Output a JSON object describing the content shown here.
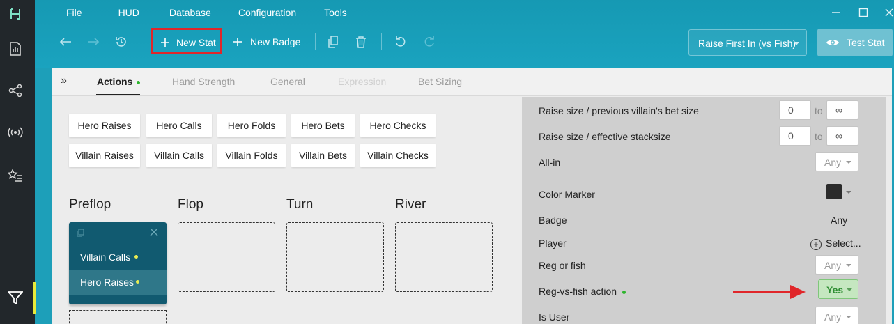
{
  "app": {
    "logo": "logo-h-icon"
  },
  "menu": [
    "File",
    "HUD",
    "Database",
    "Configuration",
    "Tools"
  ],
  "toolbar": {
    "new_stat": "New Stat",
    "new_badge": "New Badge",
    "raise_select": "Raise First In (vs Fish)",
    "test_stat": "Test Stat"
  },
  "tabs": [
    {
      "label": "Actions",
      "state": "active"
    },
    {
      "label": "Hand Strength",
      "state": "inactive"
    },
    {
      "label": "General",
      "state": "inactive"
    },
    {
      "label": "Expression",
      "state": "disabled"
    },
    {
      "label": "Bet Sizing",
      "state": "inactive"
    }
  ],
  "hero_actions": [
    "Hero Raises",
    "Hero Calls",
    "Hero Folds",
    "Hero Bets",
    "Hero Checks"
  ],
  "villain_actions": [
    "Villain Raises",
    "Villain Calls",
    "Villain Folds",
    "Villain Bets",
    "Villain Checks"
  ],
  "streets": [
    "Preflop",
    "Flop",
    "Turn",
    "River"
  ],
  "preflop_card": {
    "rows": [
      "Villain Calls",
      "Hero Raises"
    ]
  },
  "filters": {
    "raise_prev": {
      "label": "Raise size / previous villain's bet size",
      "from": "0",
      "to_label": "to",
      "to": "∞"
    },
    "raise_stack": {
      "label": "Raise size / effective stacksize",
      "from": "0",
      "to_label": "to",
      "to": "∞"
    },
    "all_in": {
      "label": "All-in",
      "value": "Any"
    },
    "color_marker": {
      "label": "Color Marker",
      "color": "#2b2b2b"
    },
    "badge": {
      "label": "Badge",
      "value": "Any"
    },
    "player": {
      "label": "Player",
      "value": "Select..."
    },
    "reg_or_fish": {
      "label": "Reg or fish",
      "value": "Any"
    },
    "reg_vs_fish": {
      "label": "Reg-vs-fish action",
      "value": "Yes"
    },
    "is_user": {
      "label": "Is User",
      "value": "Any"
    }
  },
  "colors": {
    "accent": "#1d9fb9",
    "sidebar": "#22272b",
    "card": "#115a70",
    "highlight": "#e0262a",
    "active_dot": "#2db52d"
  }
}
